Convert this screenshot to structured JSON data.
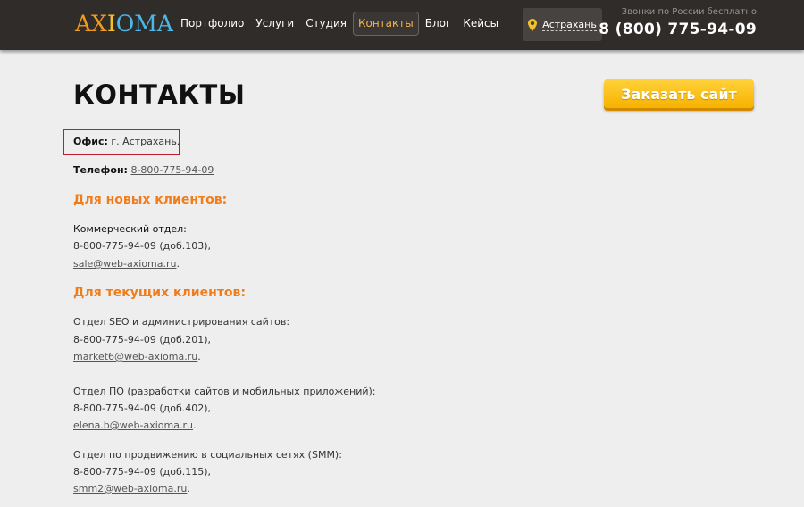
{
  "header": {
    "logo": {
      "ax": "AX",
      "i": "I",
      "oma": "OMA"
    },
    "nav": [
      {
        "label": "Портфолио",
        "active": false
      },
      {
        "label": "Услуги",
        "active": false
      },
      {
        "label": "Студия",
        "active": false
      },
      {
        "label": "Контакты",
        "active": true
      },
      {
        "label": "Блог",
        "active": false
      },
      {
        "label": "Кейсы",
        "active": false
      }
    ],
    "city": "Астрахань",
    "free_calls": "Звонки по России бесплатно",
    "hotline": "8 (800) 775-94-09"
  },
  "page": {
    "title": "КОНТАКТЫ",
    "order_button": "Заказать сайт",
    "office_label": "Офис:",
    "office_value": " г. Астрахань.",
    "phone_label": "Телефон:",
    "phone_value": "8-800-775-94-09",
    "new_clients": {
      "heading": "Для новых клиентов:",
      "dept": "Коммерческий отдел:",
      "phone": "8-800-775-94-09 (доб.103),",
      "email": "sale@web-axioma.ru",
      "email_suffix": "."
    },
    "current_clients": {
      "heading": "Для текущих клиентов:",
      "depts": [
        {
          "name": "Отдел SEO и администрирования сайтов:",
          "phone": "8-800-775-94-09 (доб.201),",
          "email": "market6@web-axioma.ru",
          "suffix": "."
        },
        {
          "name": "Отдел ПО (разработки сайтов и мобильных приложений):",
          "phone": "8-800-775-94-09 (доб.402),",
          "email": "elena.b@web-axioma.ru",
          "suffix": "."
        },
        {
          "name": "Отдел по продвижению в социальных сетях (SMM):",
          "phone": "8-800-775-94-09 (доб.115),",
          "email": "smm2@web-axioma.ru",
          "suffix": "."
        }
      ]
    }
  },
  "colors": {
    "header_bg": "#2f2c2a",
    "accent_orange": "#f07d1a",
    "button_yellow": "#f7b200",
    "highlight_red": "#c21b2c"
  }
}
